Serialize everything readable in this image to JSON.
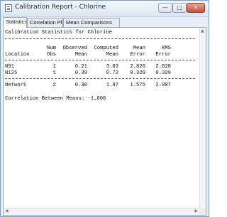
{
  "window": {
    "title": "Calibration Report - Chlorine",
    "buttons": {
      "minimize": "—",
      "maximize": "□",
      "close": "✕"
    }
  },
  "tabs": [
    {
      "label": "Statistics",
      "active": true
    },
    {
      "label": "Correlation Plot",
      "active": false
    },
    {
      "label": "Mean Comparisons",
      "active": false
    }
  ],
  "report": {
    "heading": "Calibration Statistics for Chlorine",
    "columns": [
      {
        "line1": "",
        "line2": "Location"
      },
      {
        "line1": "Num",
        "line2": "Obs"
      },
      {
        "line1": "Observed",
        "line2": "Mean"
      },
      {
        "line1": "Computed",
        "line2": "Mean"
      },
      {
        "line1": "Mean",
        "line2": "Error"
      },
      {
        "line1": "RMS",
        "line2": "Error"
      }
    ],
    "rows": [
      {
        "location": "N91",
        "num_obs": "1",
        "observed_mean": "0.21",
        "computed_mean": "3.03",
        "mean_error": "2.820",
        "rms_error": "2.820"
      },
      {
        "location": "N125",
        "num_obs": "1",
        "observed_mean": "0.39",
        "computed_mean": "0.72",
        "mean_error": "0.329",
        "rms_error": "0.329"
      }
    ],
    "summary": {
      "location": "Network",
      "num_obs": "2",
      "observed_mean": "0.30",
      "computed_mean": "1.87",
      "mean_error": "1.575",
      "rms_error": "2.007"
    },
    "correlation": "Correlation Between Means: -1.000"
  },
  "scrollbars": {
    "up_arrow": "▲",
    "left_arrow": "◀",
    "right_arrow": "▶"
  }
}
